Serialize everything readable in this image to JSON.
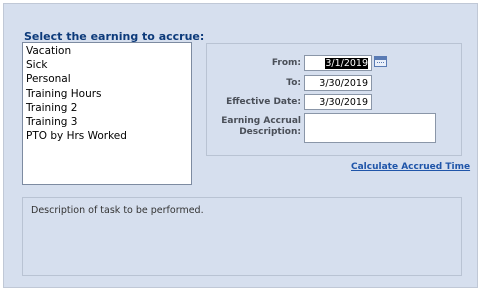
{
  "section_title": "Select the earning to accrue:",
  "earnings": [
    "Vacation",
    "Sick",
    "Personal",
    "Training Hours",
    "Training 2",
    "Training 3",
    "PTO by Hrs Worked"
  ],
  "form": {
    "from_label": "From:",
    "from_value_prefix": "",
    "from_value_selected": "3/1/2019",
    "to_label": "To:",
    "to_value": "3/30/2019",
    "effective_label": "Effective Date:",
    "effective_value": "3/30/2019",
    "accrual_desc_label_line1": "Earning Accrual",
    "accrual_desc_label_line2": "Description:",
    "accrual_desc_value": ""
  },
  "calculate_link": "Calculate Accrued Time",
  "task_description": "Description of task to be performed.",
  "icons": {
    "calendar": "calendar-icon"
  },
  "colors": {
    "panel_bg": "#d6dfee",
    "heading": "#0c3a7a",
    "link": "#1f55a9"
  }
}
